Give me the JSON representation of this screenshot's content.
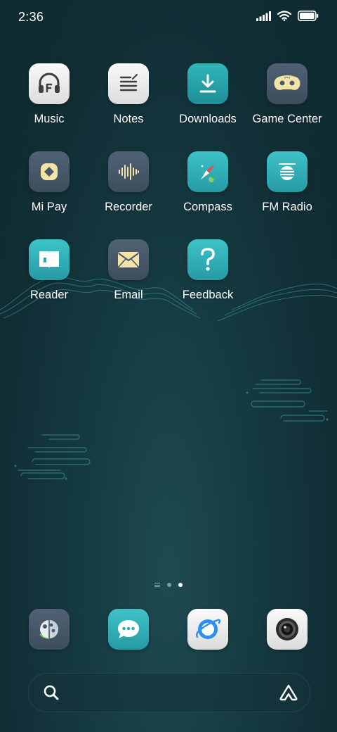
{
  "status_bar": {
    "time": "2:36",
    "icons": [
      "signal-icon",
      "wifi-icon",
      "battery-icon"
    ]
  },
  "apps": [
    {
      "label": "Music",
      "icon": "headphones-icon"
    },
    {
      "label": "Notes",
      "icon": "notes-icon"
    },
    {
      "label": "Downloads",
      "icon": "download-icon"
    },
    {
      "label": "Game Center",
      "icon": "gamepad-icon"
    },
    {
      "label": "Mi Pay",
      "icon": "mipay-icon"
    },
    {
      "label": "Recorder",
      "icon": "soundwave-icon"
    },
    {
      "label": "Compass",
      "icon": "compass-icon"
    },
    {
      "label": "FM Radio",
      "icon": "radio-icon"
    },
    {
      "label": "Reader",
      "icon": "book-icon"
    },
    {
      "label": "Email",
      "icon": "envelope-icon"
    },
    {
      "label": "Feedback",
      "icon": "question-icon"
    }
  ],
  "page_indicator": {
    "pages": 2,
    "active_index": 1
  },
  "dock": [
    {
      "icon": "gallery-icon"
    },
    {
      "icon": "messages-icon"
    },
    {
      "icon": "browser-icon"
    },
    {
      "icon": "camera-icon"
    }
  ],
  "search_bar": {
    "icons": [
      "search-icon",
      "assistant-icon"
    ]
  },
  "colors": {
    "background": "#163b42",
    "teal_icon": "#2fb6b9",
    "slate_icon": "#46586a",
    "accent_cream": "#f3e3a6"
  }
}
